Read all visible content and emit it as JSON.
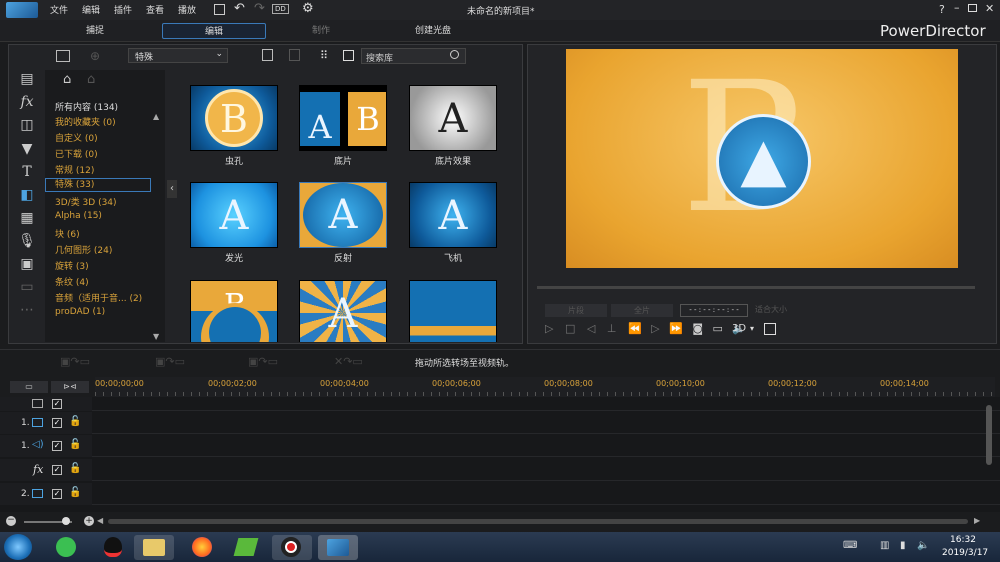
{
  "menu": [
    "文件",
    "编辑",
    "插件",
    "查看",
    "播放"
  ],
  "window_title": "未命名的新项目*",
  "timecode_toolbar": "DD",
  "modes": [
    "捕捉",
    "编辑",
    "制作",
    "创建光盘"
  ],
  "brand": "PowerDirector",
  "library": {
    "dropdown": "特殊",
    "search_placeholder": "搜索库",
    "categories": [
      {
        "label": "所有内容 (134)",
        "color": "white"
      },
      {
        "label": "我的收藏夹 (0)",
        "color": "accent"
      },
      {
        "label": "自定义 (0)",
        "color": "accent"
      },
      {
        "label": "已下载 (0)",
        "color": "accent"
      },
      {
        "label": "常规 (12)",
        "color": "accent"
      },
      {
        "label": "特殊 (33)",
        "color": "accent",
        "selected": true
      },
      {
        "label": "3D/类 3D (34)",
        "color": "accent"
      },
      {
        "label": "Alpha (15)",
        "color": "accent"
      },
      {
        "label": "块 (6)",
        "color": "accent"
      },
      {
        "label": "几何图形 (24)",
        "color": "accent"
      },
      {
        "label": "旋转 (3)",
        "color": "accent"
      },
      {
        "label": "条纹 (4)",
        "color": "accent"
      },
      {
        "label": "音频（适用于音... (2)",
        "color": "accent"
      },
      {
        "label": "proDAD (1)",
        "color": "accent"
      }
    ],
    "thumbnails": [
      "虫孔",
      "底片",
      "底片效果",
      "发光",
      "反射",
      "飞机",
      "",
      "",
      ""
    ]
  },
  "preview": {
    "btn_clip": "片段",
    "btn_movie": "全片",
    "timecode": "- - : - - : - - : - -",
    "fit": "适合大小",
    "mode3d": "3D"
  },
  "timeline": {
    "hint": "拖动所选转场至视频轨。",
    "ticks": [
      "00;00;00;00",
      "00;00;02;00",
      "00;00;04;00",
      "00;00;06;00",
      "00;00;08;00",
      "00;00;10;00",
      "00;00;12;00",
      "00;00;14;00"
    ],
    "tracks": [
      "",
      "1.",
      "1.",
      "",
      "2."
    ]
  },
  "taskbar": {
    "time": "16:32",
    "date": "2019/3/17"
  },
  "colors": {
    "accent": "#d8a23a",
    "selection": "#3a79b8"
  }
}
